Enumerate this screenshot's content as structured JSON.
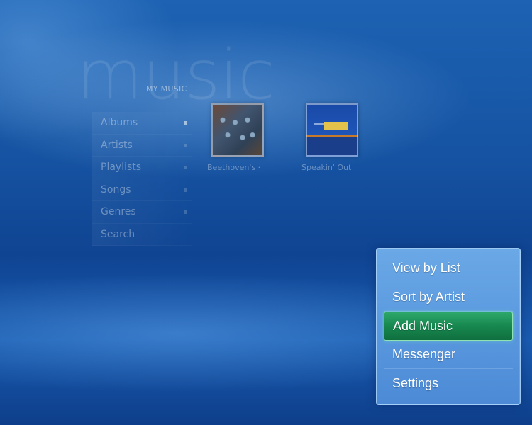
{
  "app": {
    "title": "music",
    "section": "MY MUSIC"
  },
  "nav": {
    "items": [
      {
        "label": "Albums",
        "active": true
      },
      {
        "label": "Artists"
      },
      {
        "label": "Playlists"
      },
      {
        "label": "Songs"
      },
      {
        "label": "Genres"
      },
      {
        "label": "Search"
      }
    ]
  },
  "albums": [
    {
      "title": "Beethoven's ·",
      "cover": "orchestra-cover"
    },
    {
      "title": "Speakin' Out",
      "cover": "jazz-cover"
    }
  ],
  "context_menu": {
    "items": [
      {
        "label": "View by List"
      },
      {
        "label": "Sort by Artist"
      },
      {
        "label": "Add Music",
        "selected": true
      },
      {
        "label": "Messenger"
      },
      {
        "label": "Settings"
      }
    ]
  },
  "colors": {
    "background": "#1654a3",
    "menu": "#5a99df",
    "selected": "#17874f"
  }
}
